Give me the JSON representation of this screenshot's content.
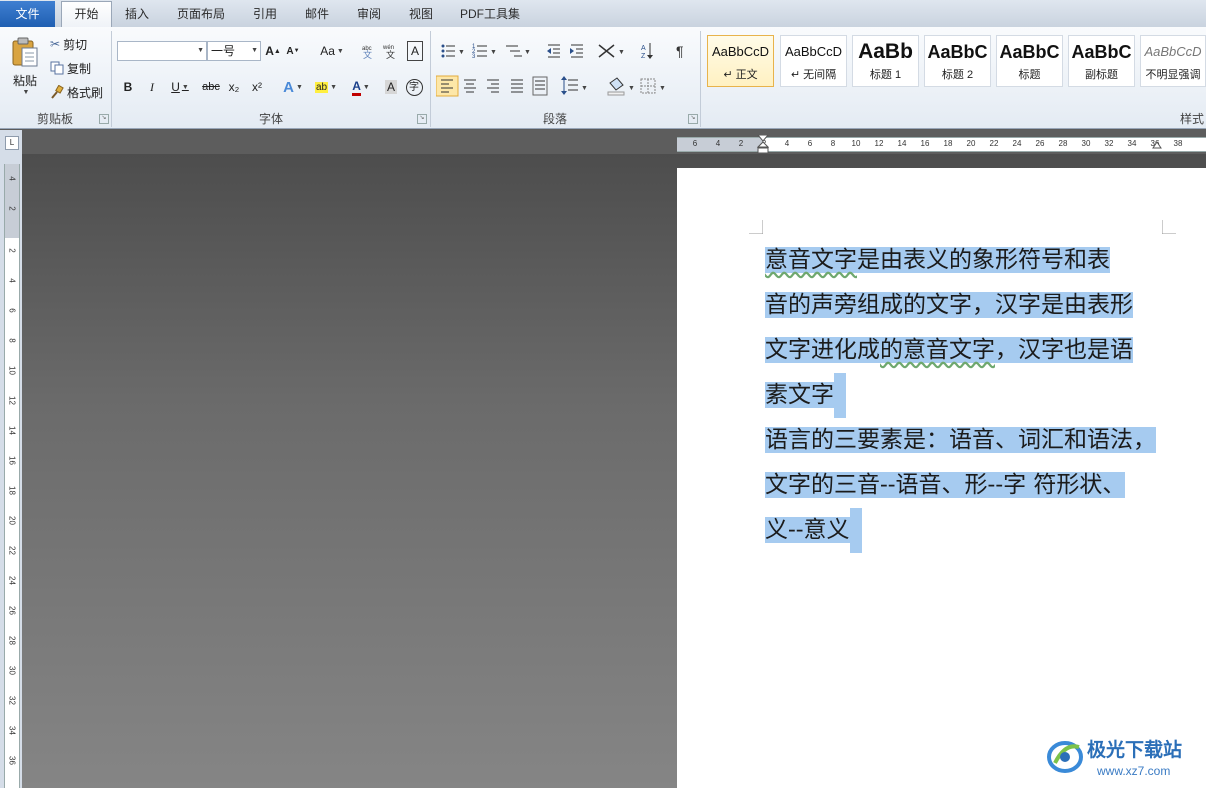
{
  "tabs": {
    "file": "文件",
    "home": "开始",
    "insert": "插入",
    "layout": "页面布局",
    "references": "引用",
    "mailings": "邮件",
    "review": "审阅",
    "view": "视图",
    "pdf": "PDF工具集"
  },
  "clipboard": {
    "paste": "粘贴",
    "cut": "剪切",
    "copy": "复制",
    "format_painter": "格式刷",
    "label": "剪贴板"
  },
  "font": {
    "name_value": "",
    "size_value": "一号",
    "label": "字体",
    "grow": "A",
    "shrink": "A",
    "change_case": "Aa",
    "clear_format": "A",
    "bold": "B",
    "italic": "I",
    "underline": "U",
    "strike": "abc",
    "subscript": "x₂",
    "superscript": "x²",
    "text_effect": "A",
    "highlight": "ab",
    "font_color": "A",
    "char_shading": "A",
    "enclose": "字"
  },
  "paragraph": {
    "label": "段落"
  },
  "styles": {
    "label": "样式",
    "items": [
      {
        "preview": "AaBbCcD",
        "name": "↵ 正文"
      },
      {
        "preview": "AaBbCcD",
        "name": "↵ 无间隔"
      },
      {
        "preview": "AaBb",
        "name": "标题 1"
      },
      {
        "preview": "AaBbC",
        "name": "标题 2"
      },
      {
        "preview": "AaBbC",
        "name": "标题"
      },
      {
        "preview": "AaBbC",
        "name": "副标题"
      },
      {
        "preview": "AaBbCcD",
        "name": "不明显强调"
      }
    ]
  },
  "hruler_ticks": [
    "6",
    "4",
    "2",
    "2",
    "4",
    "6",
    "8",
    "10",
    "12",
    "14",
    "16",
    "18",
    "20",
    "22",
    "24",
    "26",
    "28",
    "30",
    "32",
    "34",
    "36",
    "38"
  ],
  "vruler_ticks": [
    "4",
    "2",
    "2",
    "4",
    "6",
    "8",
    "10",
    "12",
    "14",
    "16",
    "18",
    "20",
    "22",
    "24",
    "26",
    "28",
    "30",
    "32",
    "34",
    "36"
  ],
  "document": {
    "lines": [
      {
        "pre": "",
        "squig": "意音文字",
        "post": "是由表义的象形符号和表"
      },
      {
        "pre": "音的声旁组成的文字，汉字是由表形",
        "squig": "",
        "post": ""
      },
      {
        "pre": "文字进化成",
        "squig": "的意音文字",
        "post": "，汉字也是语"
      },
      {
        "pre": "素文字",
        "squig": "",
        "post": ""
      },
      {
        "pre": "语言的三要素是：语音、词汇和语法，",
        "squig": "",
        "post": ""
      },
      {
        "pre": "文字的三音--语音、形--字 符形状、",
        "squig": "",
        "post": ""
      },
      {
        "pre": "义--意义",
        "squig": "",
        "post": ""
      }
    ]
  },
  "watermark": {
    "name": "极光下载站",
    "url": "www.xz7.com"
  },
  "colors": {
    "selection": "#a6cbf0",
    "file_tab": "#2a6cc2",
    "workspace": "#5b5b5b"
  }
}
